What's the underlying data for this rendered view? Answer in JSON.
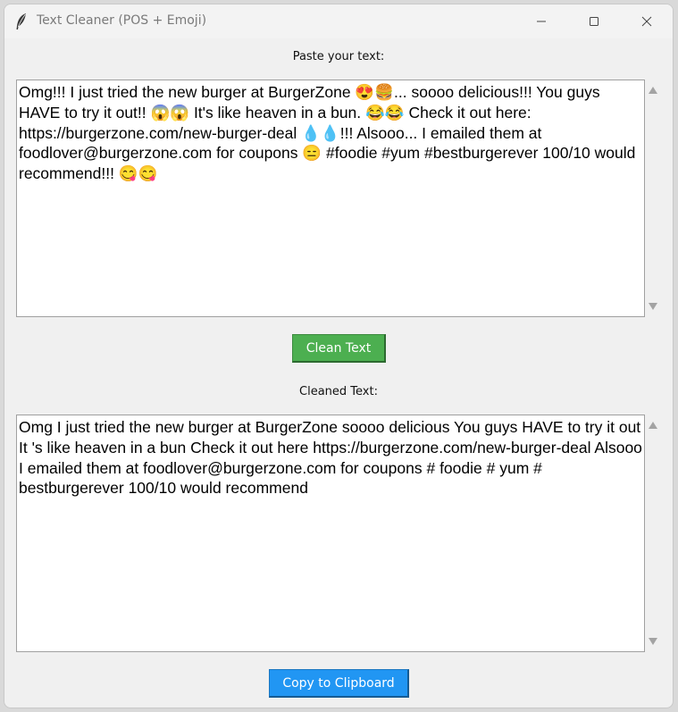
{
  "window": {
    "title": "Text Cleaner (POS + Emoji)",
    "app_icon": "feather-icon",
    "controls": [
      "minimize-icon",
      "maximize-icon",
      "close-icon"
    ]
  },
  "input": {
    "label": "Paste your text:",
    "value": "Omg!!! I just tried the new burger at BurgerZone 😍🍔... soooo delicious!!! You guys HAVE to try it out!! 😱😱 It's like heaven in a bun. 😂😂 Check it out here: https://burgerzone.com/new-burger-deal 💧💧!!! Alsooo... I emailed them at foodlover@burgerzone.com for coupons 😑 #foodie #yum #bestburgerever 100/10 would recommend!!! 😋😋"
  },
  "actions": {
    "clean_label": "Clean Text",
    "copy_label": "Copy to Clipboard"
  },
  "output": {
    "label": "Cleaned Text:",
    "value": "Omg I just tried the new burger at BurgerZone soooo delicious You guys HAVE to try it out It 's like heaven in a bun Check it out here https://burgerzone.com/new-burger-deal Alsooo I emailed them at foodlover@burgerzone.com for coupons # foodie # yum # bestburgerever 100/10 would recommend"
  },
  "colors": {
    "clean_button": "#4caf50",
    "copy_button": "#2196f3",
    "window_bg": "#f0f0f0"
  }
}
